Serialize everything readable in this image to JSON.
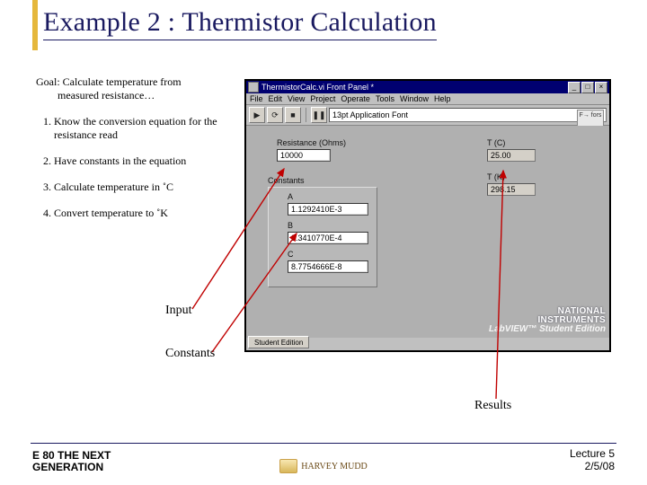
{
  "title": "Example 2 : Thermistor Calculation",
  "goal_line1": "Goal: Calculate temperature from",
  "goal_line2": "measured resistance…",
  "steps": [
    "Know the conversion equation for the resistance read",
    "Have constants in the equation",
    "Calculate temperature in ˚C",
    "Convert temperature to ˚K"
  ],
  "callouts": {
    "input": "Input",
    "constants": "Constants",
    "results": "Results"
  },
  "labview": {
    "window_title": "ThermistorCalc.vi Front Panel *",
    "menus": [
      "File",
      "Edit",
      "View",
      "Project",
      "Operate",
      "Tools",
      "Window",
      "Help"
    ],
    "font_label": "13pt Application Font",
    "vi_badge": "F→ fors",
    "toolbar_icons": [
      "run-arrow-icon",
      "run-cont-icon",
      "abort-icon",
      "pause-icon"
    ],
    "window_buttons": {
      "min": "_",
      "max": "□",
      "close": "×"
    },
    "fields": {
      "resistance_label": "Resistance (Ohms)",
      "resistance_value": "10000",
      "tc_label": "T (C)",
      "tc_value": "25.00",
      "tk_label": "T (K)",
      "tk_value": "298.15",
      "constants_label": "Constants",
      "A_label": "A",
      "A_value": "1.1292410E-3",
      "B_label": "B",
      "B_value": "2.3410770E-4",
      "C_label": "C",
      "C_value": "8.7754666E-8"
    },
    "status": "Student Edition",
    "brand_top": "NATIONAL",
    "brand_mid": "INSTRUMENTS",
    "brand_bot": "LabVIEW™ Student Edition"
  },
  "footer": {
    "left_l1": "E 80 THE NEXT",
    "left_l2": "GENERATION",
    "center": "HARVEY MUDD",
    "right_l1": "Lecture 5",
    "right_l2": "2/5/08"
  }
}
